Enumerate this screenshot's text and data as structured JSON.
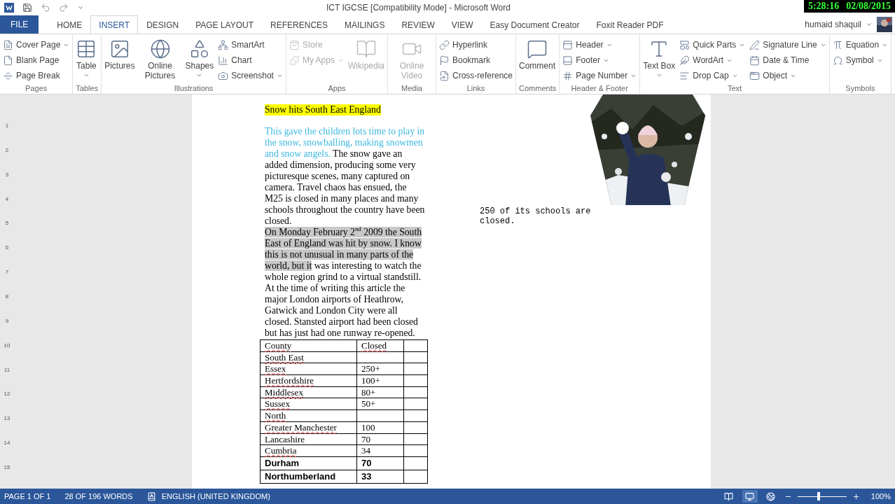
{
  "title_bar": {
    "title": "ICT IGCSE [Compatibility Mode] - Microsoft Word",
    "clock": {
      "time": "5:28:16",
      "date": "02/08/2015"
    }
  },
  "file_tab": {
    "label": "FILE"
  },
  "tabs": [
    {
      "label": "HOME",
      "selected": false
    },
    {
      "label": "INSERT",
      "selected": true
    },
    {
      "label": "DESIGN",
      "selected": false
    },
    {
      "label": "PAGE LAYOUT",
      "selected": false
    },
    {
      "label": "REFERENCES",
      "selected": false
    },
    {
      "label": "MAILINGS",
      "selected": false
    },
    {
      "label": "REVIEW",
      "selected": false
    },
    {
      "label": "VIEW",
      "selected": false
    },
    {
      "label": "Easy Document Creator",
      "selected": false
    },
    {
      "label": "Foxit Reader PDF",
      "selected": false
    }
  ],
  "account": {
    "name": "humaid shaquil"
  },
  "ribbon": {
    "groups": [
      {
        "label": "Pages",
        "columns": [
          {
            "kind": "stack",
            "items": [
              {
                "label": "Cover Page",
                "dropdown": true,
                "disabled": false
              },
              {
                "label": "Blank Page",
                "dropdown": false,
                "disabled": false
              },
              {
                "label": "Page Break",
                "dropdown": false,
                "disabled": false
              }
            ]
          }
        ]
      },
      {
        "label": "Tables",
        "columns": [
          {
            "kind": "large",
            "items": [
              {
                "label": "Table",
                "dropdown": true,
                "disabled": false
              }
            ]
          }
        ]
      },
      {
        "label": "Illustrations",
        "columns": [
          {
            "kind": "large",
            "items": [
              {
                "label": "Pictures",
                "dropdown": false,
                "disabled": false
              }
            ]
          },
          {
            "kind": "large",
            "items": [
              {
                "label": "Online Pictures",
                "dropdown": false,
                "disabled": false
              }
            ]
          },
          {
            "kind": "large",
            "items": [
              {
                "label": "Shapes",
                "dropdown": true,
                "disabled": false
              }
            ]
          },
          {
            "kind": "stack",
            "items": [
              {
                "label": "SmartArt",
                "dropdown": false,
                "disabled": false
              },
              {
                "label": "Chart",
                "dropdown": false,
                "disabled": false
              },
              {
                "label": "Screenshot",
                "dropdown": true,
                "disabled": false
              }
            ]
          }
        ]
      },
      {
        "label": "Apps",
        "columns": [
          {
            "kind": "stack",
            "items": [
              {
                "label": "Store",
                "dropdown": false,
                "disabled": true
              },
              {
                "label": "My Apps",
                "dropdown": true,
                "disabled": true
              }
            ]
          },
          {
            "kind": "large",
            "items": [
              {
                "label": "Wikipedia",
                "dropdown": false,
                "disabled": true
              }
            ]
          }
        ]
      },
      {
        "label": "Media",
        "columns": [
          {
            "kind": "large",
            "items": [
              {
                "label": "Online Video",
                "dropdown": false,
                "disabled": true
              }
            ]
          }
        ]
      },
      {
        "label": "Links",
        "columns": [
          {
            "kind": "stack",
            "items": [
              {
                "label": "Hyperlink",
                "dropdown": false,
                "disabled": false
              },
              {
                "label": "Bookmark",
                "dropdown": false,
                "disabled": false
              },
              {
                "label": "Cross-reference",
                "dropdown": false,
                "disabled": false
              }
            ]
          }
        ]
      },
      {
        "label": "Comments",
        "columns": [
          {
            "kind": "large",
            "items": [
              {
                "label": "Comment",
                "dropdown": false,
                "disabled": false
              }
            ]
          }
        ]
      },
      {
        "label": "Header & Footer",
        "columns": [
          {
            "kind": "stack",
            "items": [
              {
                "label": "Header",
                "dropdown": true,
                "disabled": false
              },
              {
                "label": "Footer",
                "dropdown": true,
                "disabled": false
              },
              {
                "label": "Page Number",
                "dropdown": true,
                "disabled": false
              }
            ]
          }
        ]
      },
      {
        "label": "Text",
        "columns": [
          {
            "kind": "large",
            "items": [
              {
                "label": "Text Box",
                "dropdown": true,
                "disabled": false
              }
            ]
          },
          {
            "kind": "stack",
            "items": [
              {
                "label": "Quick Parts",
                "dropdown": true,
                "disabled": false
              },
              {
                "label": "WordArt",
                "dropdown": true,
                "disabled": false
              },
              {
                "label": "Drop Cap",
                "dropdown": true,
                "disabled": false
              }
            ]
          },
          {
            "kind": "stack",
            "items": [
              {
                "label": "Signature Line",
                "dropdown": true,
                "disabled": false
              },
              {
                "label": "Date & Time",
                "dropdown": false,
                "disabled": false
              },
              {
                "label": "Object",
                "dropdown": true,
                "disabled": false
              }
            ]
          }
        ]
      },
      {
        "label": "Symbols",
        "columns": [
          {
            "kind": "stack",
            "items": [
              {
                "label": "Equation",
                "dropdown": true,
                "disabled": false
              },
              {
                "label": "Symbol",
                "dropdown": true,
                "disabled": false
              }
            ]
          }
        ]
      }
    ]
  },
  "ruler": {
    "marks": [
      "1",
      "2",
      "3",
      "4",
      "5",
      "6",
      "7",
      "8",
      "9",
      "10",
      "11",
      "12",
      "13",
      "14",
      "15"
    ]
  },
  "document": {
    "heading": {
      "text": "Snow hits South East England",
      "highlight": true
    },
    "paragraphs": [
      {
        "runs": [
          {
            "text": "This gave the children lots time to play in the snow, snowballing, making snowmen and snow angels.",
            "color": "#3cb8e0",
            "highlight": false
          },
          {
            "text": " The snow gave an added dimension, producing some very picturesque scenes, many captured on camera. Travel chaos has ensued, the M25 is closed in many places and many schools throughout the country have been closed.",
            "color": "#000000",
            "highlight": false
          }
        ]
      },
      {
        "runs": [
          {
            "text": "On Monday February 2$^{nd}$ 2009 the South East of England was hit by snow. I know this is not unusual in many parts of the world, but it",
            "color": "#000000",
            "highlight": true
          },
          {
            "text": " was interesting to watch the whole region grind to a virtual standstill. At the time of writing this article the major London airports of Heathrow, Gatwick and London City were all closed. Stansted airport had been closed but has just had one runway re-opened.",
            "color": "#000000",
            "highlight": false
          }
        ]
      }
    ],
    "table": {
      "columns": [
        {
          "text": "County",
          "flagged": true
        },
        {
          "text": "Closed",
          "flagged": true
        }
      ],
      "rows": [
        {
          "bold": false,
          "cells": [
            {
              "text": "South East",
              "flagged": true
            }
          ]
        },
        {
          "bold": false,
          "cells": [
            {
              "text": "Essex",
              "flagged": true
            },
            {
              "text": "250+",
              "flagged": false
            }
          ]
        },
        {
          "bold": false,
          "cells": [
            {
              "text": "Hertfordshire",
              "flagged": true
            },
            {
              "text": "100+",
              "flagged": false
            }
          ]
        },
        {
          "bold": false,
          "cells": [
            {
              "text": "Middlesex",
              "flagged": true
            },
            {
              "text": "80+",
              "flagged": false
            }
          ]
        },
        {
          "bold": false,
          "cells": [
            {
              "text": "Sussex",
              "flagged": true
            },
            {
              "text": "50+",
              "flagged": false
            }
          ]
        },
        {
          "bold": false,
          "cells": [
            {
              "text": "North",
              "flagged": true
            }
          ]
        },
        {
          "bold": false,
          "cells": [
            {
              "text": "Greater Manchester",
              "flagged": true
            },
            {
              "text": "100",
              "flagged": false
            }
          ]
        },
        {
          "bold": false,
          "cells": [
            {
              "text": "Lancashire",
              "flagged": false
            },
            {
              "text": "70",
              "flagged": false
            }
          ]
        },
        {
          "bold": false,
          "cells": [
            {
              "text": "Cumbria",
              "flagged": true
            },
            {
              "text": "34",
              "flagged": false
            }
          ]
        },
        {
          "bold": true,
          "cells": [
            {
              "text": "Durham",
              "flagged": false
            },
            {
              "text": "70",
              "flagged": false
            }
          ]
        },
        {
          "bold": true,
          "cells": [
            {
              "text": "Northumberland",
              "flagged": false
            },
            {
              "text": "33",
              "flagged": false
            }
          ]
        }
      ]
    },
    "side_note": "250 of its schools are closed."
  },
  "status_bar": {
    "page": "PAGE 1 OF 1",
    "words": "28 OF 196 WORDS",
    "language": "ENGLISH (UNITED KINGDOM)",
    "views": [
      {
        "selected": false
      },
      {
        "selected": true
      },
      {
        "selected": false
      }
    ],
    "zoom": {
      "level": 0.4,
      "reading": "100%"
    }
  }
}
